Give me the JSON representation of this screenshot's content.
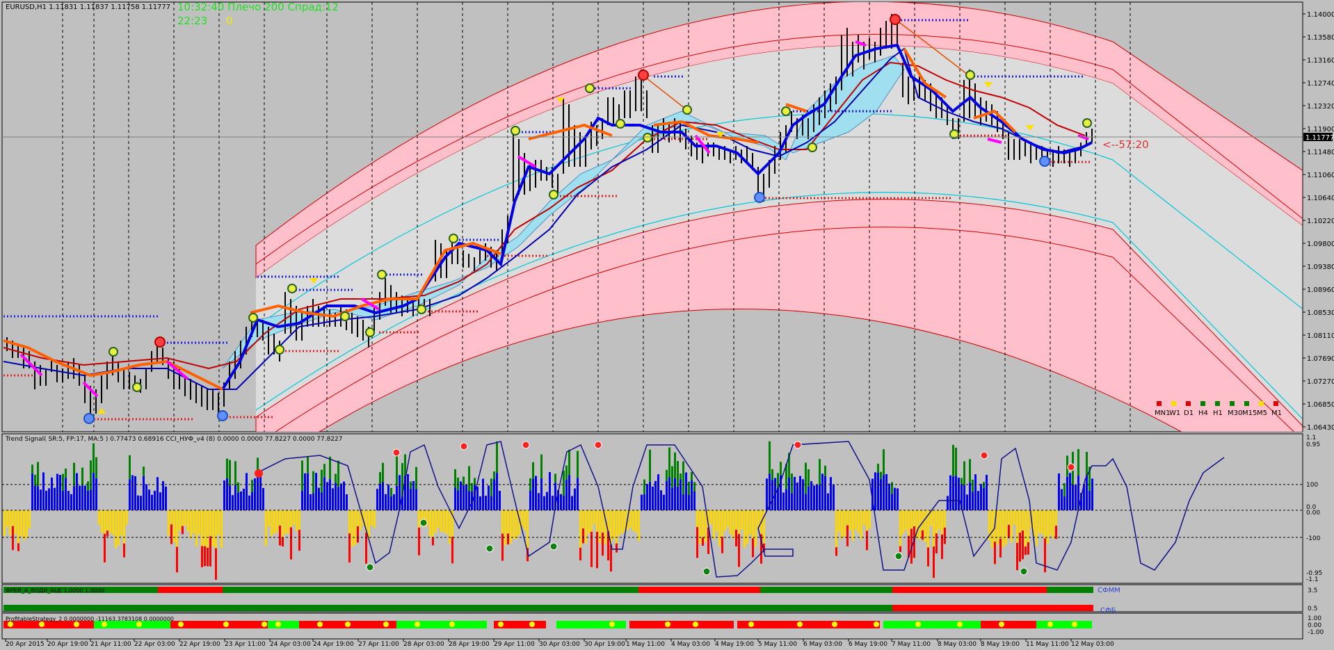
{
  "main_chart": {
    "symbol_info": "EURUSD,H1  1.11831 1.11837 1.11758 1.11777",
    "overlay_time_info": "10:32:40 Плечо 200 Спрад:12",
    "overlay_counter": "22:23",
    "overlay_zero": "0",
    "current_price_label": "1.11777",
    "timer_label": "<--57:20",
    "price_ticks": [
      "1.14000",
      "1.13580",
      "1.13160",
      "1.12740",
      "1.12320",
      "1.11900",
      "1.11480",
      "1.11060",
      "1.10640",
      "1.10220",
      "1.09800",
      "1.09380",
      "1.08960",
      "1.08530",
      "1.08110",
      "1.07690",
      "1.07270",
      "1.06850",
      "1.06430"
    ],
    "timeframes": [
      {
        "label": "MN1",
        "color": "#e00000"
      },
      {
        "label": "W1",
        "color": "#f0e000"
      },
      {
        "label": "D1",
        "color": "#e00000"
      },
      {
        "label": "H4",
        "color": "#008000"
      },
      {
        "label": "H1",
        "color": "#008000"
      },
      {
        "label": "M30",
        "color": "#008000"
      },
      {
        "label": "M15",
        "color": "#008000"
      },
      {
        "label": "M5",
        "color": "#f0e000"
      },
      {
        "label": "M1",
        "color": "#e00000"
      }
    ]
  },
  "trend_panel": {
    "title": "Trend Signal( SR:5, FP:17, MA:5 ) 0.77473 0.68916  CCI_НУФ_v4 (8) 0.0000 0.0000 77.8227 0.0000 77.8227",
    "scale_labels": [
      "1.1",
      "0.95",
      "100",
      "0.0",
      "0.00",
      "-100",
      "-0.95",
      "-1.1"
    ]
  },
  "sfmm_panel": {
    "title": "ФРЕЙ_А_ВОДИ_АЦЕ 1.0000 1.0000",
    "label_top": "СФММ",
    "label_bottom": "СФБ",
    "scale_labels": [
      "3.5",
      "0.5"
    ]
  },
  "profit_panel": {
    "title": "ProfitableStrategy_2  0.0000000 -11163.3783108 0.0000000",
    "scale_labels": [
      "1.00",
      "0.00",
      "-1.00"
    ]
  },
  "time_axis": [
    "20 Apr 2015",
    "20 Apr 19:00",
    "21 Apr 11:00",
    "22 Apr 03:00",
    "22 Apr 19:00",
    "23 Apr 11:00",
    "24 Apr 03:00",
    "24 Apr 19:00",
    "27 Apr 11:00",
    "28 Apr 03:00",
    "28 Apr 19:00",
    "29 Apr 11:00",
    "30 Apr 03:00",
    "30 Apr 19:00",
    "1 May 11:00",
    "4 May 03:00",
    "4 May 19:00",
    "5 May 11:00",
    "6 May 03:00",
    "6 May 19:00",
    "7 May 11:00",
    "8 May 03:00",
    "8 May 19:00",
    "11 May 11:00",
    "12 May 03:00"
  ],
  "colors": {
    "background": "#c0c0c0",
    "pink_band": "#ffc0cb",
    "light_band": "#dcdcdc",
    "cyan_channel": "#a0dff0",
    "blue_line": "#0000e0",
    "orange_line": "#ff6000",
    "magenta_line": "#ff00ff",
    "dark_red_line": "#c00000",
    "hist_blue": "#0000ff",
    "hist_yellow": "#ffd700",
    "hist_green": "#008000",
    "hist_red": "#ff0000"
  }
}
